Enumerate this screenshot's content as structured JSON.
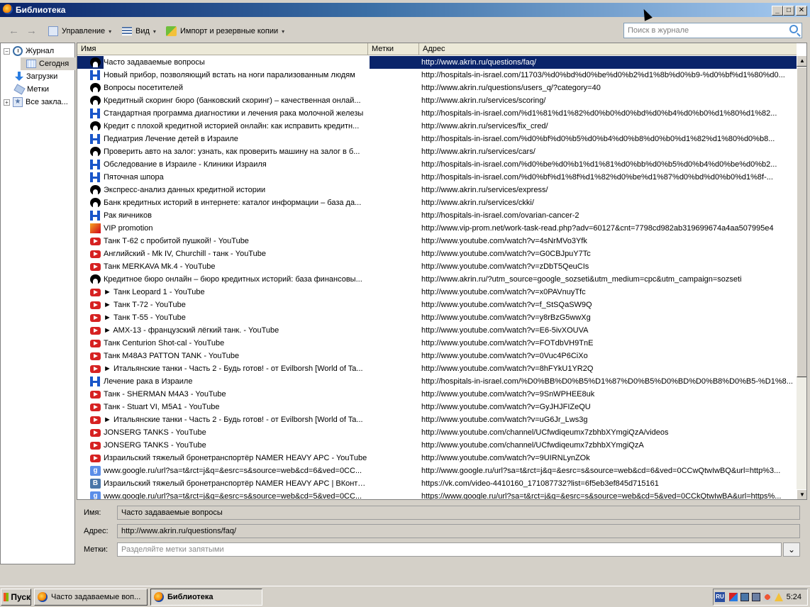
{
  "window": {
    "title": "Библиотека",
    "min_glyph": "_",
    "max_glyph": "□",
    "close_glyph": "✕"
  },
  "toolbar": {
    "back_glyph": "←",
    "forward_glyph": "→",
    "manage_label": "Управление",
    "view_label": "Вид",
    "import_label": "Импорт и резервные копии",
    "caret": "▾"
  },
  "search": {
    "placeholder": "Поиск в журнале"
  },
  "sidebar": {
    "items": [
      {
        "label": "Журнал",
        "expander": "−"
      },
      {
        "label": "Сегодня"
      },
      {
        "label": "Загрузки"
      },
      {
        "label": "Метки"
      },
      {
        "label": "Все закла...",
        "expander": "+"
      }
    ]
  },
  "table": {
    "columns": [
      "Имя",
      "Метки",
      "Адрес"
    ],
    "rows": [
      {
        "favicon": "akrin",
        "title": "Часто задаваемые вопросы",
        "url": "http://www.akrin.ru/questions/faq/"
      },
      {
        "favicon": "hospitals",
        "title": "Новый прибор, позволяющий встать на ноги парализованным людям",
        "url": "http://hospitals-in-israel.com/11703/%d0%bd%d0%be%d0%b2%d1%8b%d0%b9-%d0%bf%d1%80%d0..."
      },
      {
        "favicon": "akrin",
        "title": "Вопросы посетителей",
        "url": "http://www.akrin.ru/questions/users_q/?category=40"
      },
      {
        "favicon": "akrin",
        "title": "Кредитный скоринг бюро (банковский скоринг) – качественная онлай...",
        "url": "http://www.akrin.ru/services/scoring/"
      },
      {
        "favicon": "hospitals",
        "title": "Стандартная программа диагностики и лечения рака молочной железы",
        "url": "http://hospitals-in-israel.com/%d1%81%d1%82%d0%b0%d0%bd%d0%b4%d0%b0%d1%80%d1%82..."
      },
      {
        "favicon": "akrin",
        "title": "Кредит с плохой кредитной историей онлайн: как исправить кредитн...",
        "url": "http://www.akrin.ru/services/fix_cred/"
      },
      {
        "favicon": "hospitals",
        "title": "Педиатрия Лечение детей в Израиле",
        "url": "http://hospitals-in-israel.com/%d0%bf%d0%b5%d0%b4%d0%b8%d0%b0%d1%82%d1%80%d0%b8..."
      },
      {
        "favicon": "akrin",
        "title": "Проверить авто на залог: узнать, как проверить машину на залог в б...",
        "url": "http://www.akrin.ru/services/cars/"
      },
      {
        "favicon": "hospitals",
        "title": "Обследование в Израиле - Клиники Израиля",
        "url": "http://hospitals-in-israel.com/%d0%be%d0%b1%d1%81%d0%bb%d0%b5%d0%b4%d0%be%d0%b2..."
      },
      {
        "favicon": "hospitals",
        "title": "Пяточная шпора",
        "url": "http://hospitals-in-israel.com/%d0%bf%d1%8f%d1%82%d0%be%d1%87%d0%bd%d0%b0%d1%8f-..."
      },
      {
        "favicon": "akrin",
        "title": "Экспресс-анализ данных кредитной истории",
        "url": "http://www.akrin.ru/services/express/"
      },
      {
        "favicon": "akrin",
        "title": "Банк кредитных историй в интернете: каталог информации – база да...",
        "url": "http://www.akrin.ru/services/ckki/"
      },
      {
        "favicon": "hospitals",
        "title": "Рак яичников",
        "url": "http://hospitals-in-israel.com/ovarian-cancer-2"
      },
      {
        "favicon": "vip",
        "title": "VIP promotion",
        "url": "http://www.vip-prom.net/work-task-read.php?adv=60127&cnt=7798cd982ab319699674a4aa507995e4"
      },
      {
        "favicon": "youtube",
        "title": "Танк Т-62 с пробитой пушкой! - YouTube",
        "url": "http://www.youtube.com/watch?v=4sNrMVo3Yfk"
      },
      {
        "favicon": "youtube",
        "title": "Английский - Mk IV, Churchill - танк - YouTube",
        "url": "http://www.youtube.com/watch?v=G0CBJpuY7Tc"
      },
      {
        "favicon": "youtube",
        "title": "Танк MERKAVA Mk.4 - YouTube",
        "url": "http://www.youtube.com/watch?v=zDbT5QeuCIs"
      },
      {
        "favicon": "akrin",
        "title": "Кредитное бюро онлайн – бюро кредитных историй: база финансовы...",
        "url": "http://www.akrin.ru/?utm_source=google_sozseti&utm_medium=cpc&utm_campaign=sozseti"
      },
      {
        "favicon": "youtube",
        "title": "► Танк Leopard 1 - YouTube",
        "url": "http://www.youtube.com/watch?v=x0PAVnuyTfc"
      },
      {
        "favicon": "youtube",
        "title": "► Танк Т-72 - YouTube",
        "url": "http://www.youtube.com/watch?v=f_StSQaSW9Q"
      },
      {
        "favicon": "youtube",
        "title": "► Танк Т-55 - YouTube",
        "url": "http://www.youtube.com/watch?v=y8rBzG5wwXg"
      },
      {
        "favicon": "youtube",
        "title": "► AMX-13 - французский лёгкий танк. - YouTube",
        "url": "http://www.youtube.com/watch?v=E6-5ivXOUVA"
      },
      {
        "favicon": "youtube",
        "title": "Танк Centurion Shot-cal - YouTube",
        "url": "http://www.youtube.com/watch?v=FOTdbVH9TnE"
      },
      {
        "favicon": "youtube",
        "title": "Танк M48A3 PATTON TANK - YouTube",
        "url": "http://www.youtube.com/watch?v=0Vuc4P6CiXo"
      },
      {
        "favicon": "youtube",
        "title": "► Итальянские танки - Часть 2 - Будь готов! - от Evilborsh [World of Ta...",
        "url": "http://www.youtube.com/watch?v=8hFYkU1YR2Q"
      },
      {
        "favicon": "hospitals",
        "title": "Лечение рака в Израиле",
        "url": "http://hospitals-in-israel.com/%D0%BB%D0%B5%D1%87%D0%B5%D0%BD%D0%B8%D0%B5-%D1%8..."
      },
      {
        "favicon": "youtube",
        "title": "Танк - SHERMAN M4A3 - YouTube",
        "url": "http://www.youtube.com/watch?v=9SnWPHEE8uk"
      },
      {
        "favicon": "youtube",
        "title": "Танк - Stuart VI, M5A1 - YouTube",
        "url": "http://www.youtube.com/watch?v=GyJHJFIZeQU"
      },
      {
        "favicon": "youtube",
        "title": "► Итальянские танки - Часть 2 - Будь готов! - от Evilborsh [World of Ta...",
        "url": "http://www.youtube.com/watch?v=uG6Jr_Lws3g"
      },
      {
        "favicon": "youtube",
        "title": "JONSERG TANKS - YouTube",
        "url": "http://www.youtube.com/channel/UCfwdiqeumx7zbhbXYmgiQzA/videos"
      },
      {
        "favicon": "youtube",
        "title": "JONSERG TANKS - YouTube",
        "url": "http://www.youtube.com/channel/UCfwdiqeumx7zbhbXYmgiQzA"
      },
      {
        "favicon": "youtube",
        "title": "Израильский тяжелый бронетранспортёр NAMER HEAVY APC - YouTube",
        "url": "http://www.youtube.com/watch?v=9UIRNLynZOk"
      },
      {
        "favicon": "google",
        "title": "www.google.ru/url?sa=t&rct=j&q=&esrc=s&source=web&cd=6&ved=0CC...",
        "url": "http://www.google.ru/url?sa=t&rct=j&q=&esrc=s&source=web&cd=6&ved=0CCwQtwIwBQ&url=http%3..."
      },
      {
        "favicon": "vk",
        "title": "Израильский тяжелый бронетранспортёр NAMER HEAVY APC | ВКонтак...",
        "url": "https://vk.com/video-4410160_171087732?list=6f5eb3ef845d715161"
      },
      {
        "favicon": "google",
        "title": "www.google.ru/url?sa=t&rct=j&q=&esrc=s&source=web&cd=5&ved=0CC...",
        "url": "https://www.google.ru/url?sa=t&rct=j&q=&esrc=s&source=web&cd=5&ved=0CCkQtwIwBA&url=https%..."
      }
    ]
  },
  "scrollbar": {
    "up_glyph": "▲",
    "down_glyph": "▼"
  },
  "details": {
    "name_label": "Имя:",
    "name_value": "Часто задаваемые вопросы",
    "address_label": "Адрес:",
    "address_value": "http://www.akrin.ru/questions/faq/",
    "tags_label": "Метки:",
    "tags_placeholder": "Разделяйте метки запятыми",
    "dropdown_glyph": "⌄"
  },
  "taskbar": {
    "start_label": "Пуск",
    "tasks": [
      {
        "label": "Часто задаваемые воп..."
      },
      {
        "label": "Библиотека"
      }
    ],
    "lang": "RU",
    "clock": "5:24"
  },
  "colors": {
    "selection": "#0a246a",
    "youtube": "#d62222",
    "hospitals": "#1a56c9"
  }
}
